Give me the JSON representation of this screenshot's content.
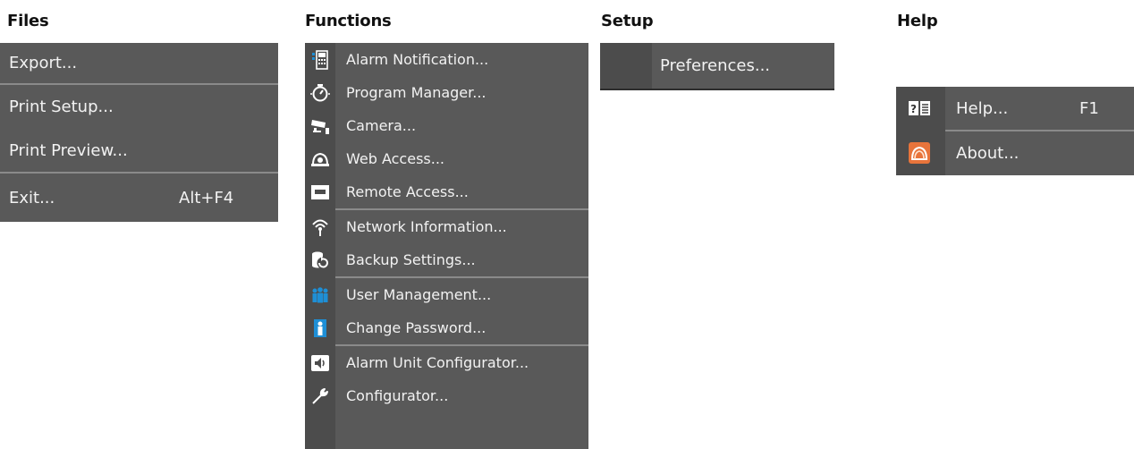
{
  "menus": {
    "files": {
      "title": "Files",
      "items": [
        {
          "label": "Export..."
        },
        {
          "label": "Print Setup..."
        },
        {
          "label": "Print Preview..."
        },
        {
          "label": "Exit...",
          "shortcut": "Alt+F4"
        }
      ]
    },
    "functions": {
      "title": "Functions",
      "items": [
        {
          "label": "Alarm Notification...",
          "icon": "alarm-notification-icon"
        },
        {
          "label": "Program Manager...",
          "icon": "timer-icon"
        },
        {
          "label": "Camera...",
          "icon": "camera-icon"
        },
        {
          "label": "Web Access...",
          "icon": "web-access-icon"
        },
        {
          "label": "Remote Access...",
          "icon": "remote-access-icon"
        },
        {
          "label": "Network Information...",
          "icon": "network-icon"
        },
        {
          "label": "Backup Settings...",
          "icon": "backup-icon"
        },
        {
          "label": "User Management...",
          "icon": "users-icon"
        },
        {
          "label": "Change Password...",
          "icon": "user-icon"
        },
        {
          "label": "Alarm Unit Configurator...",
          "icon": "speaker-icon"
        },
        {
          "label": "Configurator...",
          "icon": "wrench-icon"
        }
      ]
    },
    "setup": {
      "title": "Setup",
      "items": [
        {
          "label": "Preferences..."
        }
      ]
    },
    "help": {
      "title": "Help",
      "items": [
        {
          "label": "Help...",
          "shortcut": "F1",
          "icon": "help-book-icon"
        },
        {
          "label": "About...",
          "icon": "about-icon"
        }
      ]
    }
  },
  "colors": {
    "menu_bg": "#595959",
    "icon_strip": "#4c4c4c",
    "separator": "#8a8a8a",
    "text": "#f2f2f2",
    "accent_blue": "#1e8fd6",
    "accent_orange": "#e8743b"
  }
}
